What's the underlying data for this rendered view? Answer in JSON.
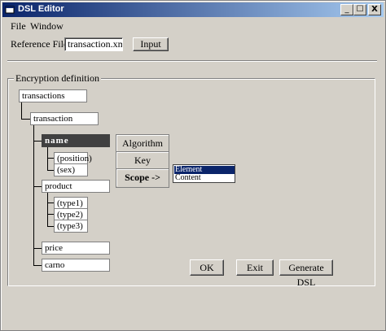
{
  "window": {
    "title": "DSL Editor",
    "minimize": "_",
    "maximize": "☐",
    "close": "X"
  },
  "menu": [
    "File",
    "Window"
  ],
  "reference": {
    "label": "Reference File:",
    "value": "transaction.xml",
    "button": "Input"
  },
  "group": {
    "title": "Encryption definition"
  },
  "tree": {
    "root": "transactions",
    "child": "transaction",
    "name": "name",
    "position": "(position)",
    "sex": "(sex)",
    "product": "product",
    "type1": "(type1)",
    "type2": "(type2)",
    "type3": "(type3)",
    "price": "price",
    "carno": "carno"
  },
  "node_menu": {
    "algorithm": "Algorithm",
    "key": "Key",
    "scope": "Scope ->"
  },
  "scope_list": {
    "options": [
      "Element",
      "Content"
    ],
    "selected": "Element"
  },
  "actions": {
    "ok": "OK",
    "exit": "Exit",
    "generate": "Generate DSL"
  }
}
